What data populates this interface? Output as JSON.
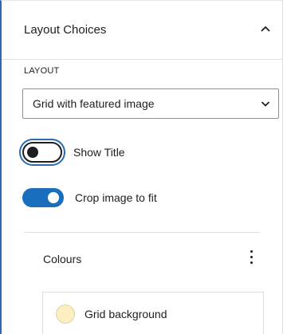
{
  "header": {
    "title": "Layout Choices"
  },
  "layout": {
    "section_label": "LAYOUT",
    "select_value": "Grid with featured image"
  },
  "toggles": [
    {
      "label": "Show Title",
      "checked": false
    },
    {
      "label": "Crop image to fit",
      "checked": true
    }
  ],
  "colours": {
    "title": "Colours",
    "items": [
      {
        "label": "Grid background",
        "swatch_color": "#fbefc1"
      }
    ]
  },
  "colors": {
    "accent": "#1a6fbd",
    "focus": "#2a6bb0"
  },
  "icons": {
    "collapse": "chevron-up-icon",
    "select": "chevron-down-icon",
    "menu": "kebab-menu-icon"
  }
}
